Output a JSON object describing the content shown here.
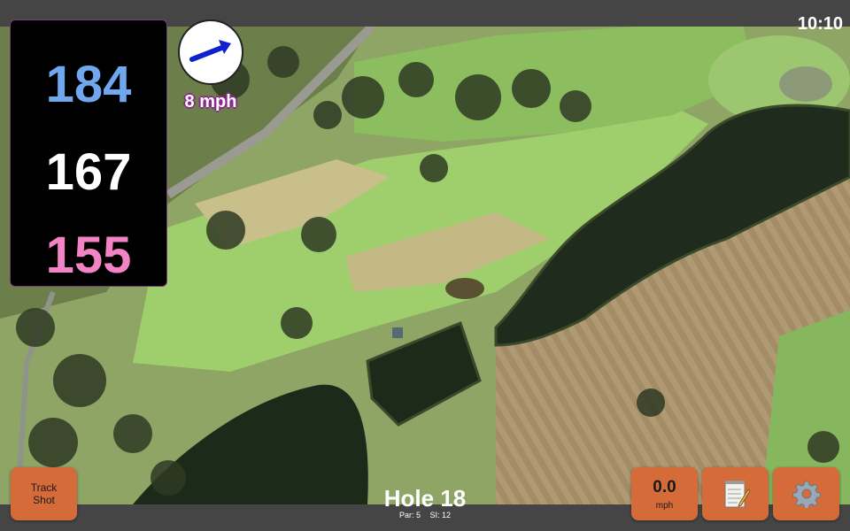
{
  "status_bar": {
    "time": "10:10"
  },
  "distances": {
    "back": "184",
    "middle": "167",
    "front": "155"
  },
  "wind": {
    "speed_label": "8 mph",
    "direction_icon": "arrow-icon"
  },
  "buttons": {
    "track_shot": {
      "label_line1": "Track",
      "label_line2": "Shot"
    },
    "speed": {
      "value": "0.0",
      "unit": "mph"
    },
    "notes": {
      "icon": "notepad-icon"
    },
    "settings": {
      "icon": "gear-icon"
    }
  },
  "hole": {
    "title": "Hole 18",
    "par": "Par: 5",
    "si": "SI: 12"
  },
  "colors": {
    "button_orange": "#d66b3a",
    "back_distance": "#6fa8ee",
    "front_distance": "#f283c4",
    "wind_arrow": "#1020d0"
  }
}
